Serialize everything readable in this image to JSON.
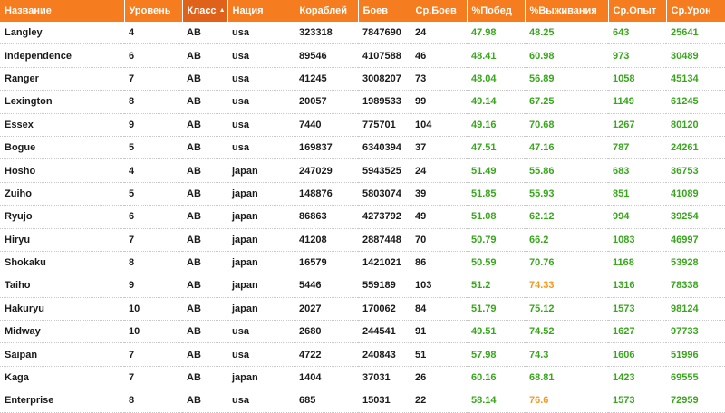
{
  "headers": [
    "Название",
    "Уровень",
    "Класс",
    "Нация",
    "Кораблей",
    "Боев",
    "Ср.Боев",
    "%Побед",
    "%Выживания",
    "Ср.Опыт",
    "Ср.Урон"
  ],
  "sorted_column": 2,
  "sort_arrow": "▲",
  "colors": {
    "header_bg": "#f57c1f",
    "good": "#3aa61e",
    "warn": "#f29a1e",
    "text": "#1a1a1a"
  },
  "rows": [
    {
      "cells": [
        "Langley",
        "4",
        "AB",
        "usa",
        "323318",
        "7847690",
        "24",
        "47.98",
        "48.25",
        "643",
        "25641"
      ],
      "surv_color": "green"
    },
    {
      "cells": [
        "Independence",
        "6",
        "AB",
        "usa",
        "89546",
        "4107588",
        "46",
        "48.41",
        "60.98",
        "973",
        "30489"
      ],
      "surv_color": "green"
    },
    {
      "cells": [
        "Ranger",
        "7",
        "AB",
        "usa",
        "41245",
        "3008207",
        "73",
        "48.04",
        "56.89",
        "1058",
        "45134"
      ],
      "surv_color": "green"
    },
    {
      "cells": [
        "Lexington",
        "8",
        "AB",
        "usa",
        "20057",
        "1989533",
        "99",
        "49.14",
        "67.25",
        "1149",
        "61245"
      ],
      "surv_color": "green"
    },
    {
      "cells": [
        "Essex",
        "9",
        "AB",
        "usa",
        "7440",
        "775701",
        "104",
        "49.16",
        "70.68",
        "1267",
        "80120"
      ],
      "surv_color": "green"
    },
    {
      "cells": [
        "Bogue",
        "5",
        "AB",
        "usa",
        "169837",
        "6340394",
        "37",
        "47.51",
        "47.16",
        "787",
        "24261"
      ],
      "surv_color": "green"
    },
    {
      "cells": [
        "Hosho",
        "4",
        "AB",
        "japan",
        "247029",
        "5943525",
        "24",
        "51.49",
        "55.86",
        "683",
        "36753"
      ],
      "surv_color": "green"
    },
    {
      "cells": [
        "Zuiho",
        "5",
        "AB",
        "japan",
        "148876",
        "5803074",
        "39",
        "51.85",
        "55.93",
        "851",
        "41089"
      ],
      "surv_color": "green"
    },
    {
      "cells": [
        "Ryujo",
        "6",
        "AB",
        "japan",
        "86863",
        "4273792",
        "49",
        "51.08",
        "62.12",
        "994",
        "39254"
      ],
      "surv_color": "green"
    },
    {
      "cells": [
        "Hiryu",
        "7",
        "AB",
        "japan",
        "41208",
        "2887448",
        "70",
        "50.79",
        "66.2",
        "1083",
        "46997"
      ],
      "surv_color": "green"
    },
    {
      "cells": [
        "Shokaku",
        "8",
        "AB",
        "japan",
        "16579",
        "1421021",
        "86",
        "50.59",
        "70.76",
        "1168",
        "53928"
      ],
      "surv_color": "green"
    },
    {
      "cells": [
        "Taiho",
        "9",
        "AB",
        "japan",
        "5446",
        "559189",
        "103",
        "51.2",
        "74.33",
        "1316",
        "78338"
      ],
      "surv_color": "orange"
    },
    {
      "cells": [
        "Hakuryu",
        "10",
        "AB",
        "japan",
        "2027",
        "170062",
        "84",
        "51.79",
        "75.12",
        "1573",
        "98124"
      ],
      "surv_color": "green"
    },
    {
      "cells": [
        "Midway",
        "10",
        "AB",
        "usa",
        "2680",
        "244541",
        "91",
        "49.51",
        "74.52",
        "1627",
        "97733"
      ],
      "surv_color": "green"
    },
    {
      "cells": [
        "Saipan",
        "7",
        "AB",
        "usa",
        "4722",
        "240843",
        "51",
        "57.98",
        "74.3",
        "1606",
        "51996"
      ],
      "surv_color": "green"
    },
    {
      "cells": [
        "Kaga",
        "7",
        "AB",
        "japan",
        "1404",
        "37031",
        "26",
        "60.16",
        "68.81",
        "1423",
        "69555"
      ],
      "surv_color": "green"
    },
    {
      "cells": [
        "Enterprise",
        "8",
        "AB",
        "usa",
        "685",
        "15031",
        "22",
        "58.14",
        "76.6",
        "1573",
        "72959"
      ],
      "surv_color": "orange"
    }
  ]
}
